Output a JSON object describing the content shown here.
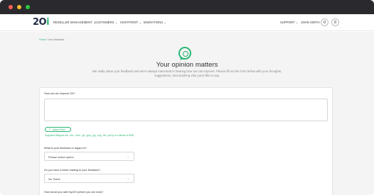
{
  "window": {
    "dots": [
      "red",
      "yellow",
      "green"
    ]
  },
  "nav": {
    "logo_main": "2O",
    "logo_accent": "i",
    "items": [
      {
        "label": "RESELLER MANAGEMENT ⌄"
      },
      {
        "label": "CUSTOMERS ⌄"
      },
      {
        "label": "HOSTPOINT ⌄"
      },
      {
        "label": "MIGRATIONS ⌄"
      }
    ],
    "support_label": "SUPPORT ⌄",
    "user_label": "JOHN SMITH",
    "icons": [
      "user-icon",
      "cart-icon"
    ]
  },
  "breadcrumb": {
    "home": "Home",
    "separator": "/",
    "current": "Your feedback"
  },
  "hero": {
    "icon": "chat-bubble-icon",
    "title": "Your opinion matters",
    "subtitle": "We really value your feedback and we're always interested in hearing how we can improve. Please fill out the form below with your thoughts, suggestions, and anything else you'd like to say."
  },
  "form": {
    "improve_label": "How can we improve 20i?",
    "attach_label": "Attach Files",
    "attach_icon": "upload-icon",
    "file_hint": "Supported filetypes are: .doc, .docx, .gif, .jpeg, .jpg, .png, .tiff, .pdf up to a filesize of 5MB",
    "feedback_type_label": "What is your feedback in regard to?",
    "feedback_type_value": "Please select option",
    "ticket_label": "Do you have a ticket relating to your feedback?",
    "ticket_value": "No Ticket",
    "rate_label": "How would you rate MyJ20 (where you are now)?"
  },
  "colors": {
    "accent": "#2bb673",
    "brand_dark": "#1f2a44",
    "page_bg": "#f4f4f4"
  }
}
